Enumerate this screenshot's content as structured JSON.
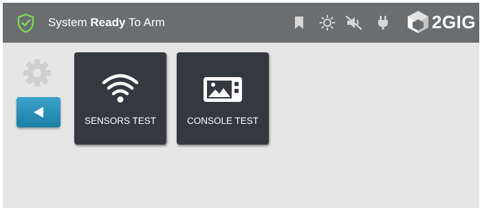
{
  "header": {
    "status_prefix": "System ",
    "status_bold": "Ready",
    "status_suffix": " To Arm",
    "logo_text": "2GIG",
    "icons": [
      "shield-check-icon",
      "bookmark-icon",
      "brightness-icon",
      "volume-mute-icon",
      "power-plug-icon",
      "2gig-cube-logo"
    ]
  },
  "sidebar": {
    "icons": [
      "gear-icon",
      "back-arrow-icon"
    ]
  },
  "tiles": [
    {
      "label": "SENSORS TEST",
      "icon": "wifi-icon"
    },
    {
      "label": "CONSOLE TEST",
      "icon": "panel-image-icon"
    }
  ],
  "colors": {
    "header_bg": "#6b6e71",
    "body_bg": "#e6e6e6",
    "shield_accent": "#7ed957",
    "tile_bg": "#34393f",
    "back_button": "#2a90b8"
  }
}
